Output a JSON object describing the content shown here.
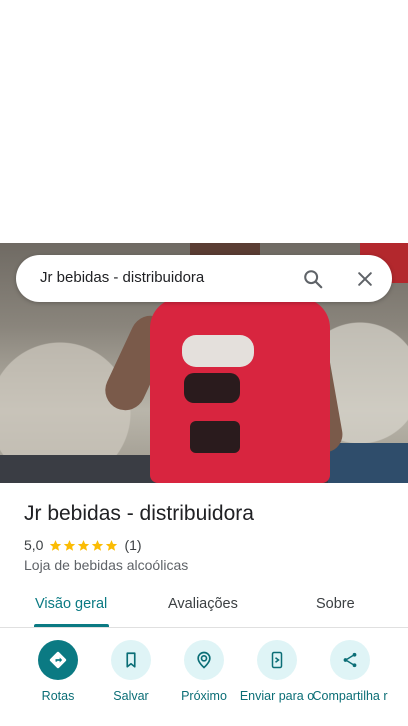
{
  "search": {
    "query": "Jr bebidas - distribuidora"
  },
  "place": {
    "title": "Jr bebidas - distribuidora",
    "rating": "5,0",
    "stars": 5,
    "review_count": "(1)",
    "category": "Loja de bebidas alcoólicas"
  },
  "tabs": [
    {
      "label": "Visão geral",
      "active": true
    },
    {
      "label": "Avaliações",
      "active": false
    },
    {
      "label": "Sobre",
      "active": false
    }
  ],
  "actions": [
    {
      "label": "Rotas",
      "icon": "directions-icon"
    },
    {
      "label": "Salvar",
      "icon": "bookmark-icon"
    },
    {
      "label": "Próximo",
      "icon": "nearby-icon"
    },
    {
      "label": "Enviar para o",
      "icon": "send-to-phone-icon"
    },
    {
      "label": "Compartilha r",
      "icon": "share-icon"
    }
  ],
  "colors": {
    "accent": "#0b7a83",
    "star": "#fbbc04",
    "action_bg": "#dff4f6"
  }
}
